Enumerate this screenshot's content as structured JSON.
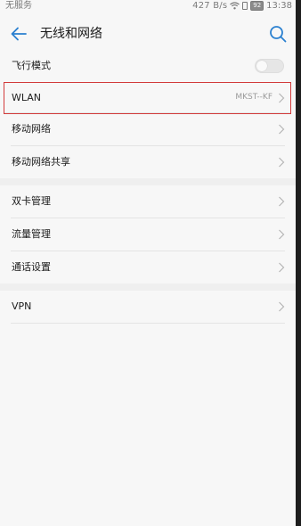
{
  "status_bar": {
    "carrier": "无服务",
    "speed": "427 B/s",
    "battery": "92",
    "time": "13:38"
  },
  "header": {
    "title": "无线和网络",
    "back_icon": "arrow-left-icon",
    "search_icon": "search-icon"
  },
  "colors": {
    "accent": "#2a80d0",
    "background": "#f7f7f7",
    "highlight_border": "#d23a3a"
  },
  "sections": [
    {
      "items": [
        {
          "label": "飞行模式",
          "control": "toggle",
          "toggle_on": false
        },
        {
          "label": "WLAN",
          "value": "MKST--KF",
          "control": "chevron"
        },
        {
          "label": "移动网络",
          "control": "chevron"
        },
        {
          "label": "移动网络共享",
          "control": "chevron"
        }
      ]
    },
    {
      "items": [
        {
          "label": "双卡管理",
          "control": "chevron"
        },
        {
          "label": "流量管理",
          "control": "chevron"
        },
        {
          "label": "通话设置",
          "control": "chevron"
        }
      ]
    },
    {
      "items": [
        {
          "label": "VPN",
          "control": "chevron"
        }
      ]
    }
  ]
}
